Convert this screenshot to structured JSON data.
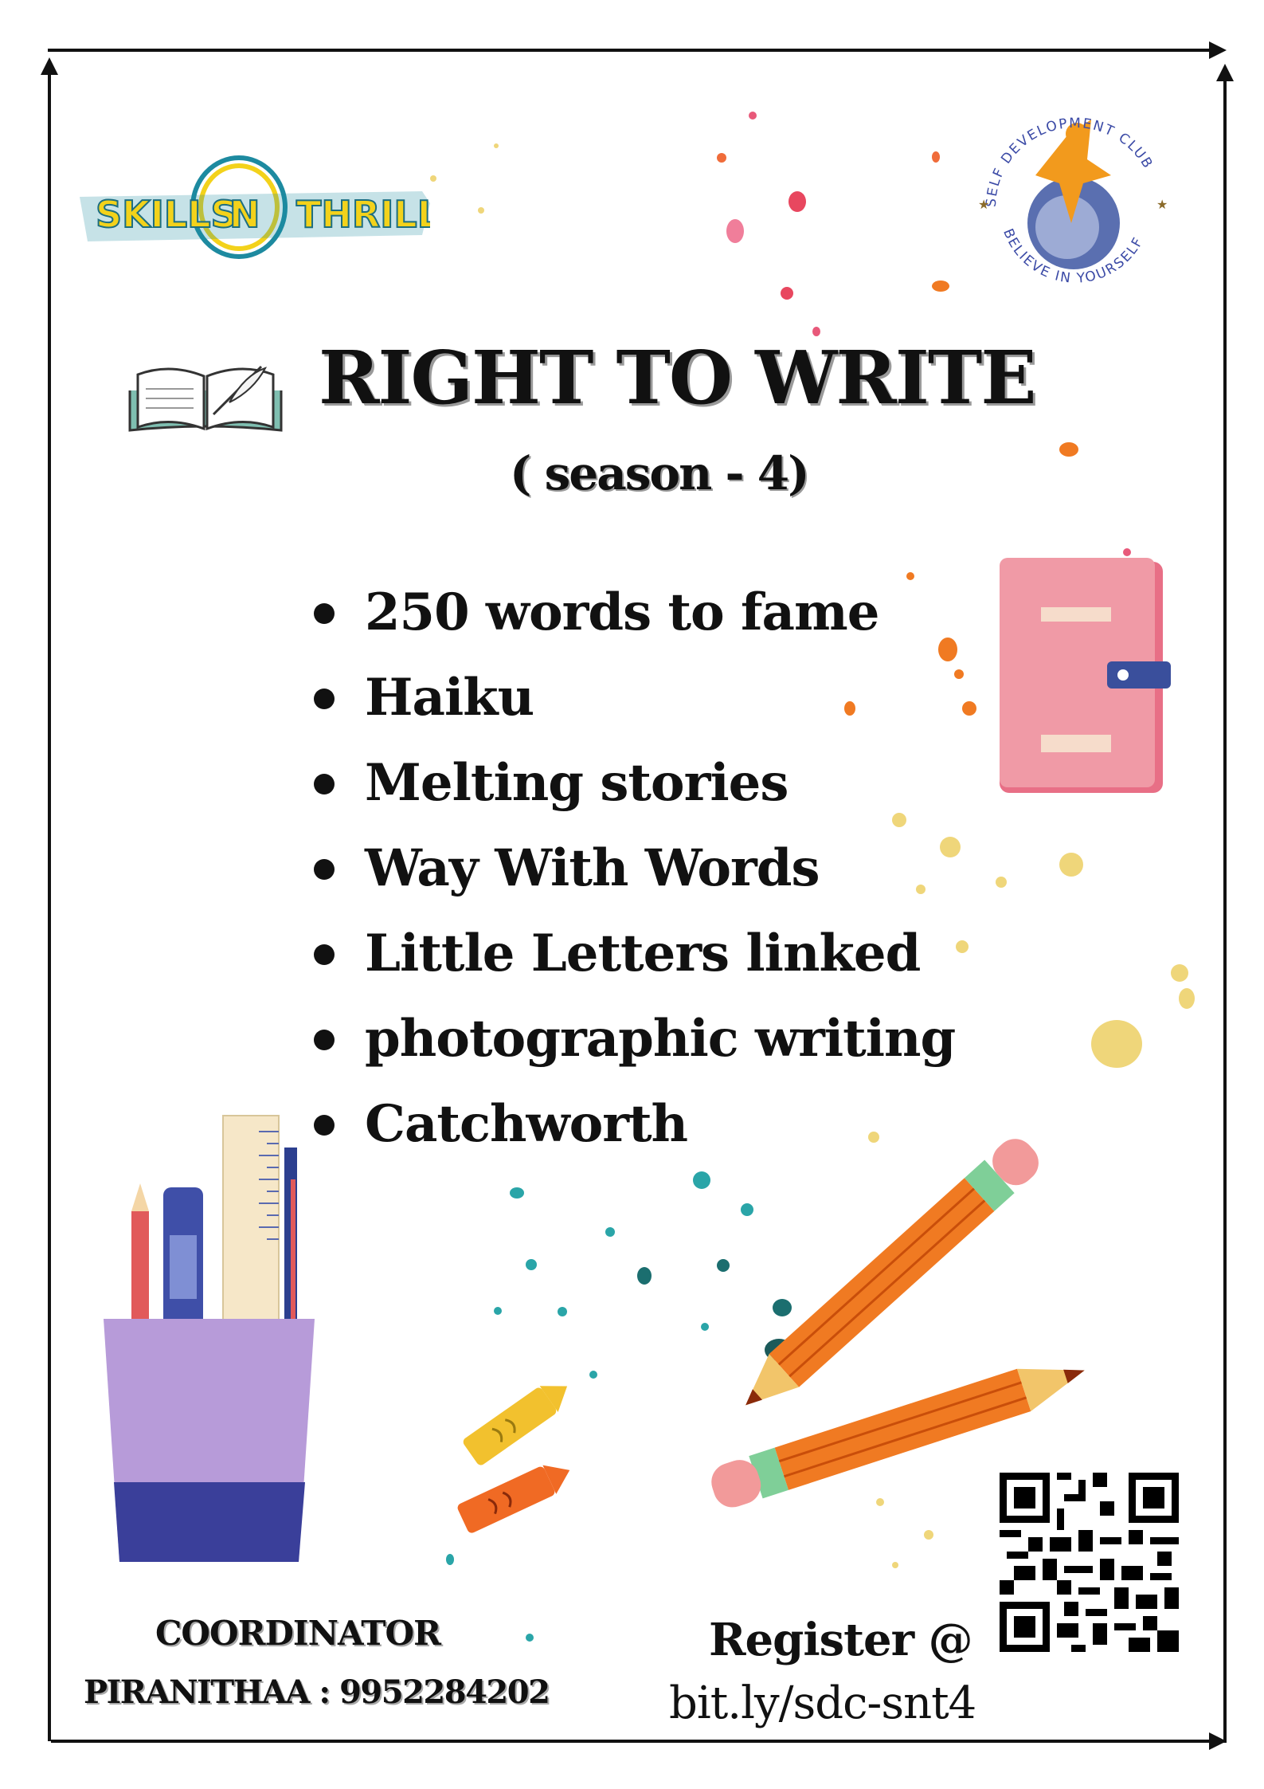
{
  "brand": {
    "left_logo_text": "SKILLS N THRILLS",
    "club_logo_top": "SELF DEVELOPMENT CLUB",
    "club_logo_bottom": "BELIEVE IN YOURSELF"
  },
  "event": {
    "title": "RIGHT TO WRITE",
    "subtitle": "( season - 4)"
  },
  "items": [
    "250  words to fame",
    "Haiku",
    "Melting stories",
    "Way With Words",
    "Little Letters linked",
    "photographic writing",
    "Catchworth"
  ],
  "coordinator": {
    "heading": "COORDINATOR",
    "name_phone": "PIRANITHAA : 9952284202"
  },
  "register": {
    "label": "Register @",
    "link": "bit.ly/sdc-snt4"
  },
  "icons": [
    "open-book-icon",
    "notebook-icon",
    "pencil-icon",
    "crayon-icon",
    "pen-holder-icon",
    "qr-code-icon"
  ],
  "colors": {
    "logo_yellow": "#f3d21b",
    "logo_teal": "#1d8aa0",
    "notebook_pink": "#f09aa6",
    "cup_purple": "#b79bd9",
    "cup_blue": "#3a3f9a",
    "pencil_orange": "#f07a22"
  }
}
